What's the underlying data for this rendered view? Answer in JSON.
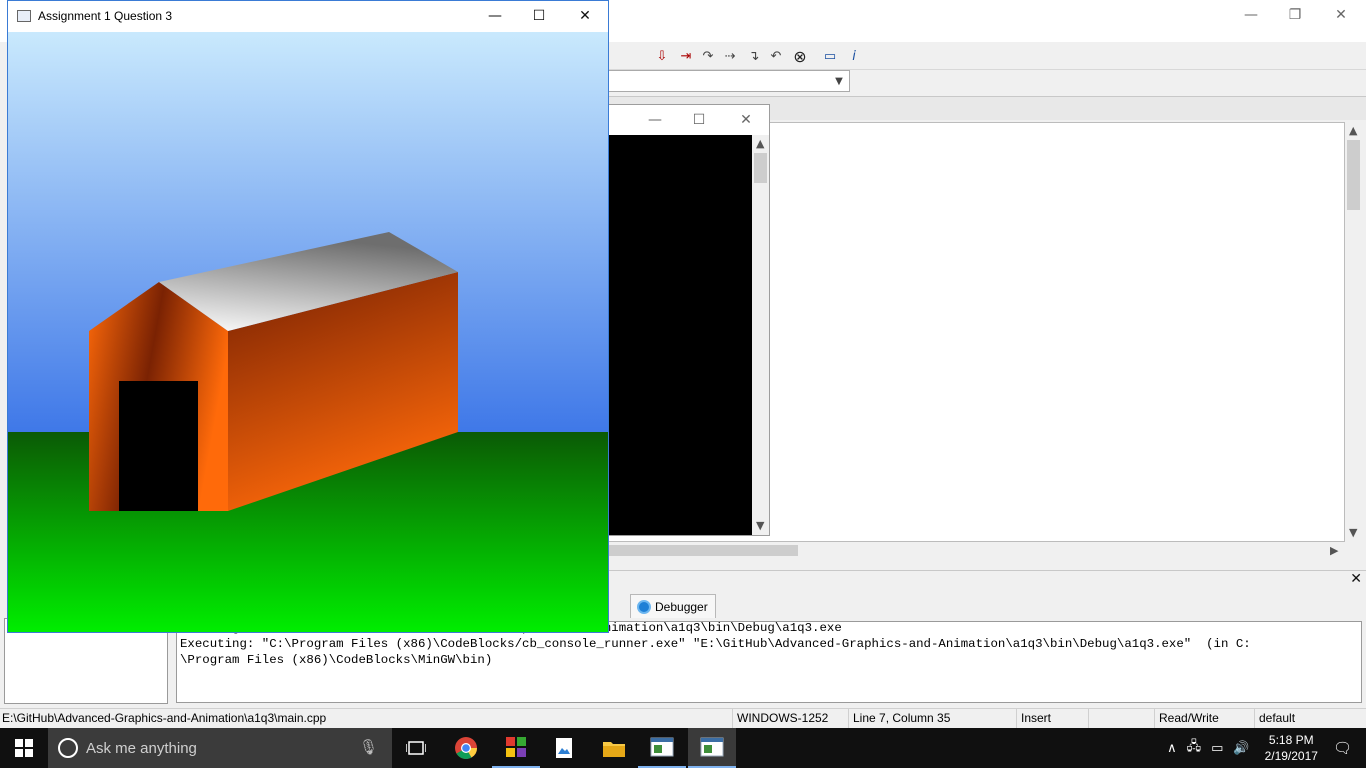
{
  "gl_window": {
    "title": "Assignment 1 Question 3",
    "minimize_glyph": "—",
    "maximize_glyph": "☐",
    "close_glyph": "✕"
  },
  "console_window": {
    "minimize_glyph": "—",
    "maximize_glyph": "☐",
    "close_glyph": "✕"
  },
  "ide": {
    "minimize_glyph": "—",
    "restore_glyph": "❐",
    "close_glyph": "✕",
    "logs_close_glyph": "✕",
    "debugger_tab_label": "Debugger",
    "log_lines": [
      "Checking for existence: E:\\GitHub\\Advanced-Graphics-and-Animation\\a1q3\\bin\\Debug\\a1q3.exe",
      "Executing: \"C:\\Program Files (x86)\\CodeBlocks/cb_console_runner.exe\" \"E:\\GitHub\\Advanced-Graphics-and-Animation\\a1q3\\bin\\Debug\\a1q3.exe\"  (in C:",
      "\\Program Files (x86)\\CodeBlocks\\MinGW\\bin)"
    ],
    "status": {
      "file_path": "E:\\GitHub\\Advanced-Graphics-and-Animation\\a1q3\\main.cpp",
      "encoding": "WINDOWS-1252",
      "position": "Line 7, Column 35",
      "mode": "Insert",
      "access": "Read/Write",
      "profile": "default"
    }
  },
  "taskbar": {
    "search_placeholder": "Ask me anything",
    "time": "5:18 PM",
    "date": "2/19/2017",
    "apps": [
      "task-view",
      "chrome",
      "codeblocks",
      "photos",
      "file-explorer",
      "console",
      "gl-app"
    ]
  },
  "scene_colors": {
    "sky_top": "#c9e9fd",
    "sky_bottom": "#3f78e8",
    "ground_top": "#0b5a05",
    "ground_bottom": "#00ee00",
    "wall_dark": "#7a2203",
    "wall_light": "#ff6a0a",
    "roof_light": "#ffffff",
    "roof_dark": "#6e6e6e",
    "door": "#000000"
  }
}
